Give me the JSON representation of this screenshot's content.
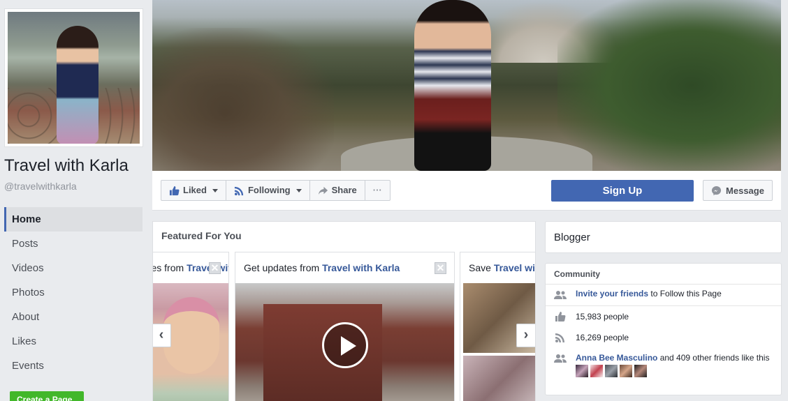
{
  "page": {
    "name": "Travel with Karla",
    "handle": "@travelwithkarla"
  },
  "nav": {
    "items": [
      "Home",
      "Posts",
      "Videos",
      "Photos",
      "About",
      "Likes",
      "Events"
    ],
    "active": "Home"
  },
  "create_page_label": "Create a Page",
  "actions": {
    "liked_label": "Liked",
    "following_label": "Following",
    "share_label": "Share",
    "more_label": "···",
    "signup_label": "Sign Up",
    "message_label": "Message"
  },
  "featured": {
    "title": "Featured For You",
    "cards": [
      {
        "text": "Get updates from ",
        "link": "Travel with Karla"
      },
      {
        "text": "Get updates from ",
        "link": "Travel with Karla"
      },
      {
        "text": "Save ",
        "link": "Travel with Karla"
      }
    ],
    "close_glyph": "✕",
    "arrow_left": "‹",
    "arrow_right": "›"
  },
  "sidebar": {
    "category": "Blogger",
    "community_title": "Community",
    "invite_link": "Invite your friends",
    "invite_text": " to Follow this Page",
    "likes_count": "15,983 people",
    "follows_count": "16,269 people",
    "friend_link": "Anna Bee Masculino",
    "friend_text": " and 409 other friends like this"
  },
  "colors": {
    "fb_blue": "#4267b2",
    "link_blue": "#365899",
    "green": "#42b72a",
    "background": "#e9ebee"
  },
  "icons": {
    "liked": "thumbs-up-icon",
    "following": "rss-icon",
    "share": "share-arrow-icon",
    "message": "messenger-icon",
    "invite": "people-icon",
    "likes": "thumbs-up-icon",
    "follows": "rss-icon",
    "friends": "people-icon"
  }
}
